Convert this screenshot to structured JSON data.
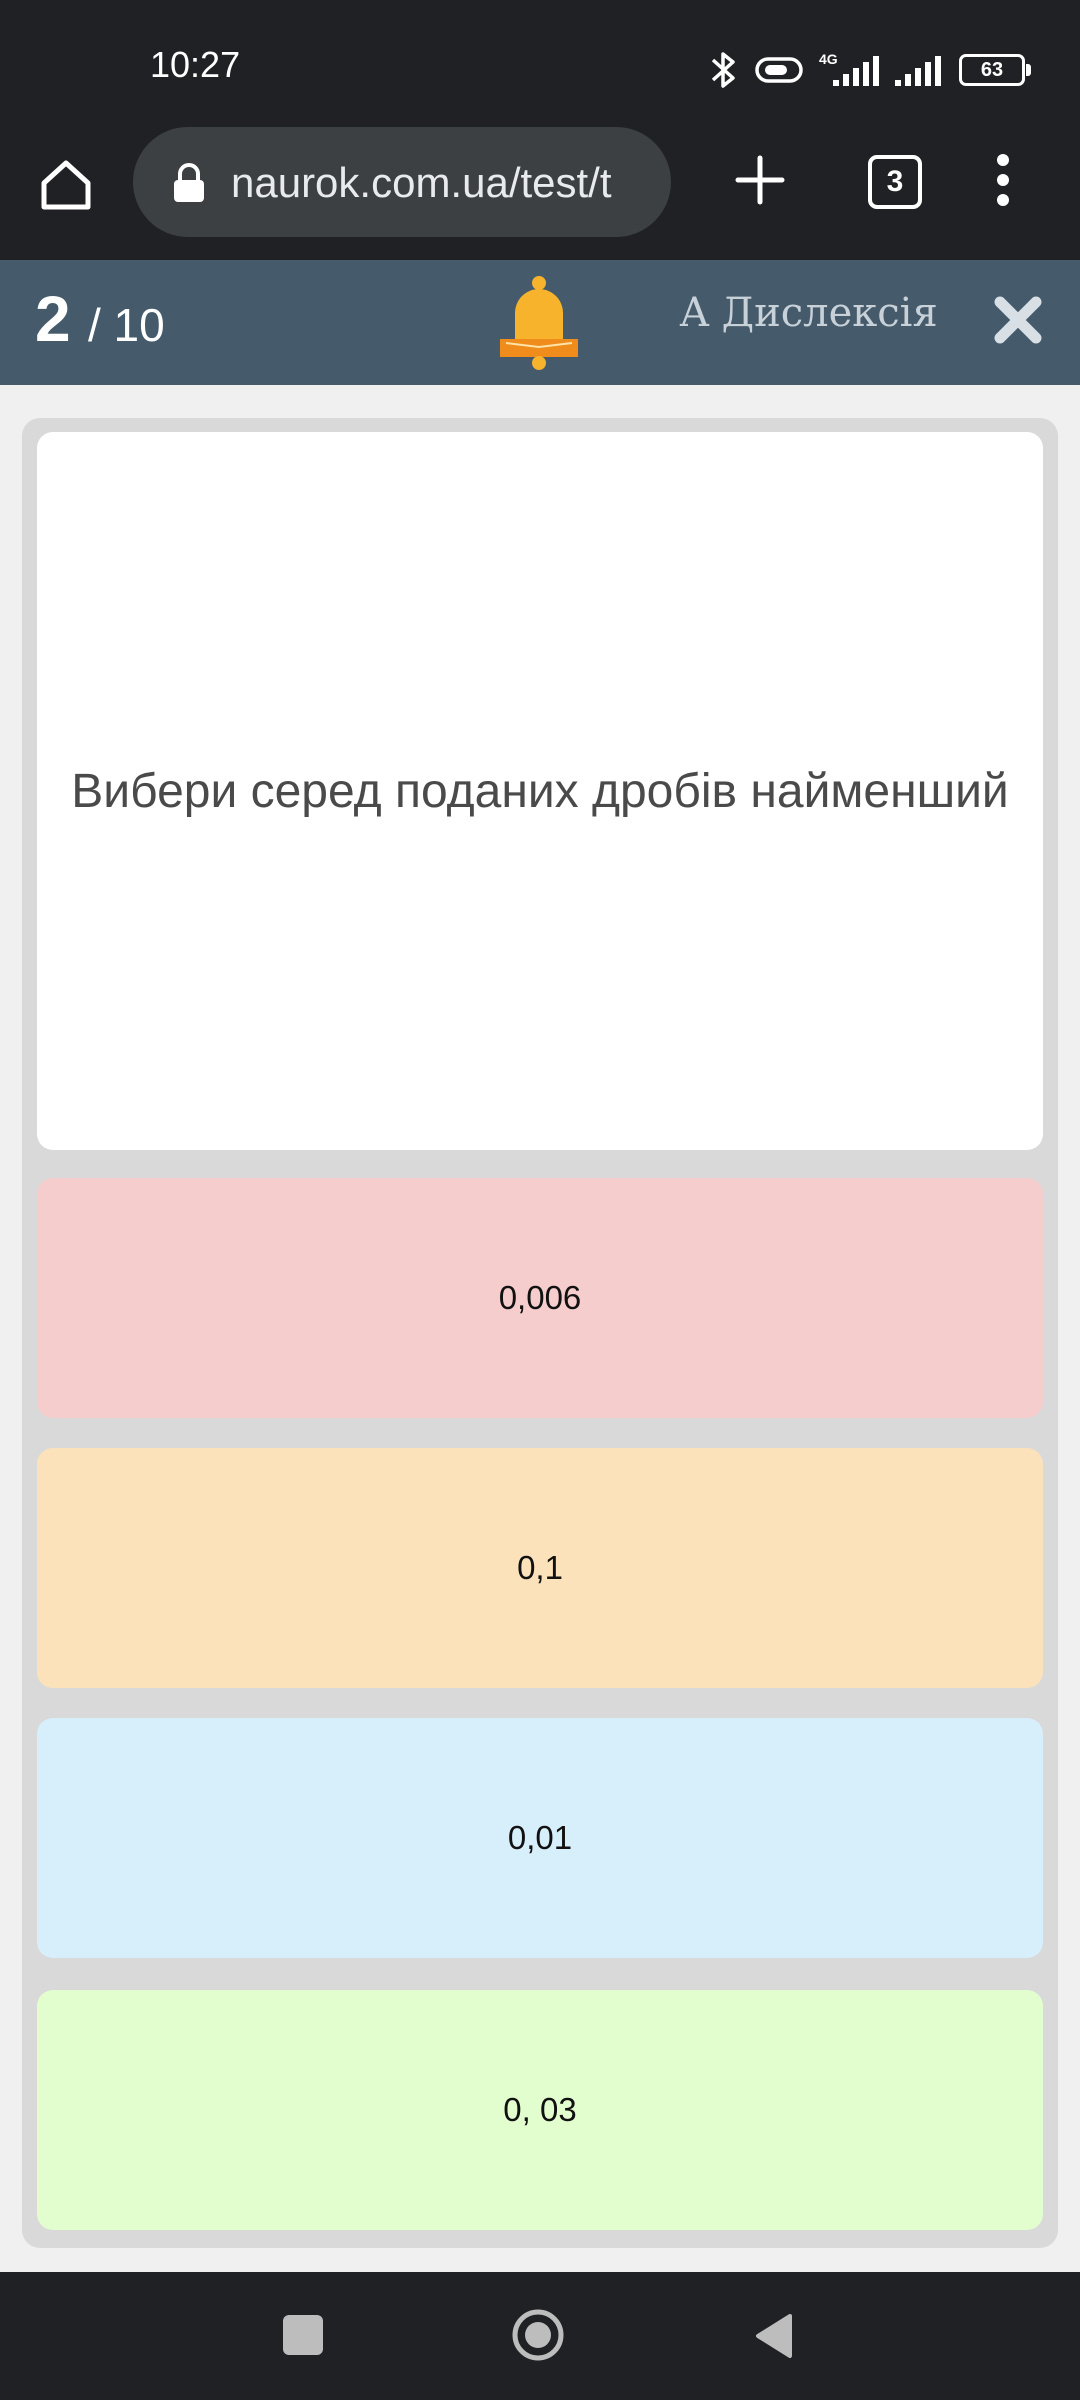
{
  "status_bar": {
    "time": "10:27",
    "network": "4G",
    "battery": "63"
  },
  "browser": {
    "url": "naurok.com.ua/test/t",
    "tab_count": "3"
  },
  "quiz_header": {
    "progress_current": "2",
    "progress_total": "/ 10",
    "dyslexia_label": "A Дислексія"
  },
  "question": {
    "text": "Вибери серед поданих дробів найменший"
  },
  "answers": [
    {
      "label": "0,006",
      "color": "#f6cdcd"
    },
    {
      "label": "0,1",
      "color": "#fbe2bb"
    },
    {
      "label": "0,01",
      "color": "#d7effa"
    },
    {
      "label": "0, 03",
      "color": "#e2fdce"
    }
  ],
  "colors": {
    "header_bg": "#455a6b",
    "bell": "#f7b32b",
    "browser_bg": "#202124"
  }
}
